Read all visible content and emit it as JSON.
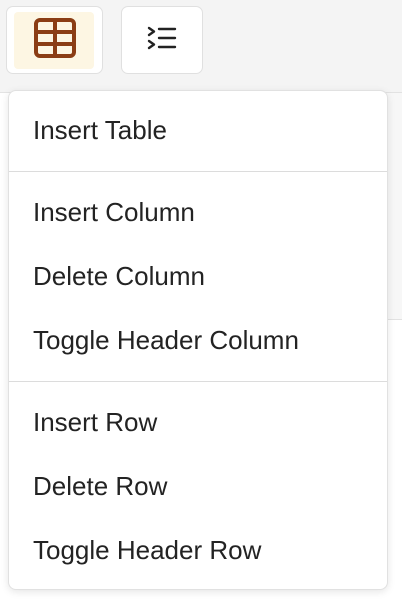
{
  "toolbar": {
    "table_button": {
      "icon": "table-icon",
      "active": true,
      "icon_color": "#8b3d14",
      "active_bg": "#fdf6e3"
    },
    "list_button": {
      "icon": "indent-list-icon"
    }
  },
  "menu": {
    "items": [
      {
        "label": "Insert Table"
      },
      {
        "label": "Insert Column"
      },
      {
        "label": "Delete Column"
      },
      {
        "label": "Toggle Header Column"
      },
      {
        "label": "Insert Row"
      },
      {
        "label": "Delete Row"
      },
      {
        "label": "Toggle Header Row"
      }
    ]
  }
}
